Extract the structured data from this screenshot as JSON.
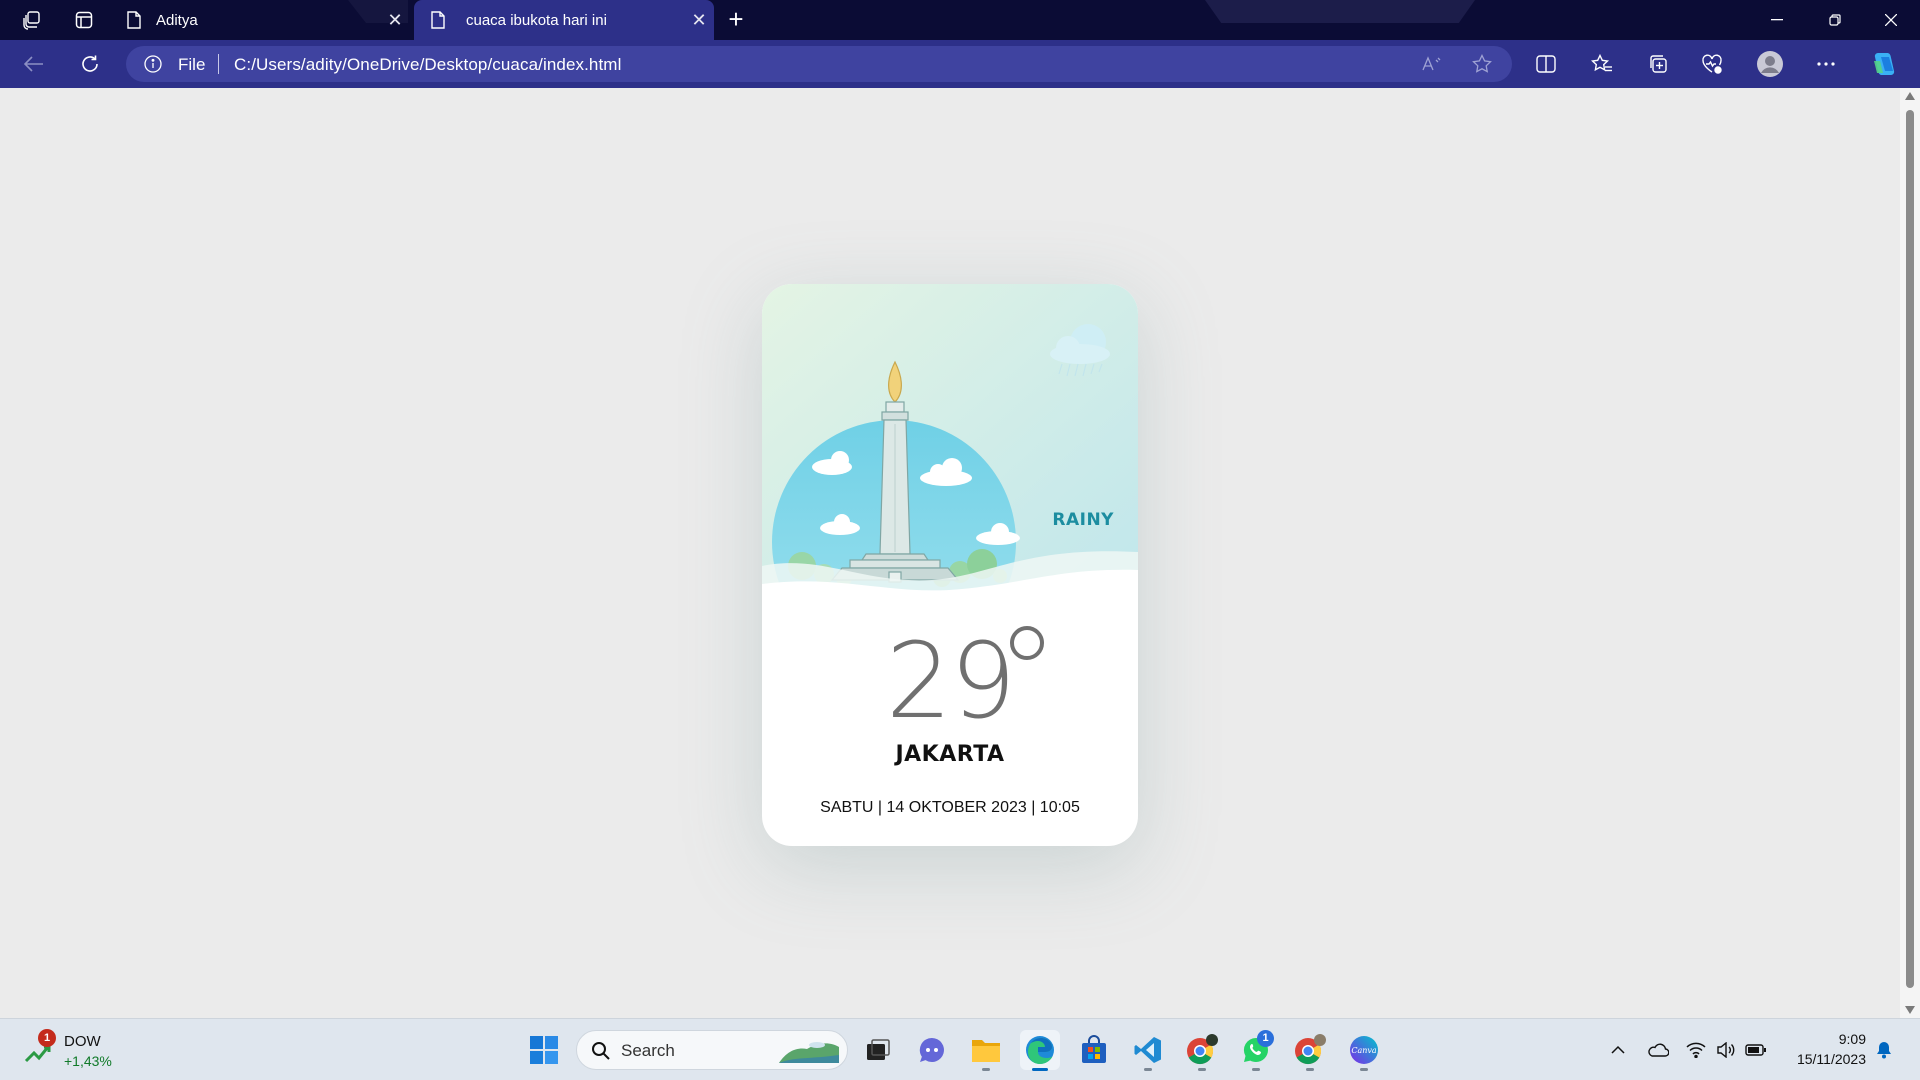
{
  "browser": {
    "tabs": [
      {
        "title": "Aditya",
        "active": false
      },
      {
        "title": "cuaca ibukota hari ini",
        "active": true
      }
    ],
    "address": {
      "scheme_label": "File",
      "url": "C:/Users/adity/OneDrive/Desktop/cuaca/index.html"
    }
  },
  "weather_card": {
    "condition": "RAINY",
    "temperature": "29",
    "city": "JAKARTA",
    "datetime": "SABTU | 14 OKTOBER 2023 | 10:05"
  },
  "taskbar": {
    "widget": {
      "badge": "1",
      "title": "DOW",
      "value": "+1,43%"
    },
    "search_label": "Search",
    "apps": [
      {
        "name": "Task View"
      },
      {
        "name": "Teams Chat"
      },
      {
        "name": "File Explorer"
      },
      {
        "name": "Microsoft Edge",
        "active": true
      },
      {
        "name": "Microsoft Store"
      },
      {
        "name": "Visual Studio Code"
      },
      {
        "name": "Google Chrome profile 1"
      },
      {
        "name": "WhatsApp",
        "badge": "1"
      },
      {
        "name": "Google Chrome profile 2"
      },
      {
        "name": "Canva",
        "label": "Canva"
      }
    ],
    "clock": {
      "time": "9:09",
      "date": "15/11/2023"
    }
  },
  "colors": {
    "tabstrip": "#0b0c35",
    "toolbar": "#2d3089",
    "page_background": "#ebebeb",
    "condition_text": "#1c8da0",
    "card_background": "#ffffff"
  }
}
